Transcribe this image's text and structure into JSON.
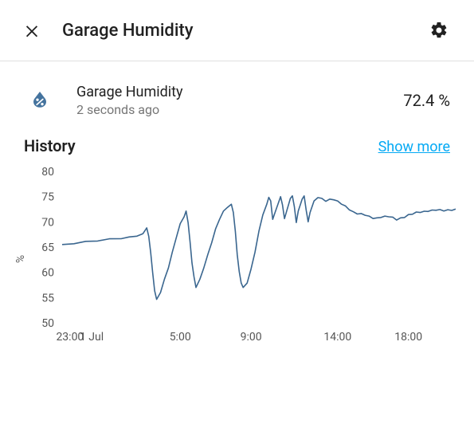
{
  "header": {
    "title": "Garage Humidity"
  },
  "entity": {
    "name": "Garage Humidity",
    "updated": "2 seconds ago",
    "value": "72.4 %"
  },
  "history": {
    "title": "History",
    "show_more": "Show more"
  },
  "colors": {
    "accent": "#03a9f4",
    "series": "#3a668f"
  },
  "chart_data": {
    "type": "line",
    "title": "",
    "xlabel": "",
    "ylabel": "%",
    "ylim": [
      50,
      80
    ],
    "y_ticks": [
      50,
      55,
      60,
      65,
      70,
      75,
      80
    ],
    "x_ticks": [
      {
        "pos": 0.02,
        "label": "23:00"
      },
      {
        "pos": 0.075,
        "label": "1 Jul"
      },
      {
        "pos": 0.3,
        "label": "5:00"
      },
      {
        "pos": 0.48,
        "label": "9:00"
      },
      {
        "pos": 0.7,
        "label": "14:00"
      },
      {
        "pos": 0.88,
        "label": "18:00"
      }
    ],
    "series": [
      {
        "name": "Garage Humidity",
        "points": [
          [
            0.0,
            65.5
          ],
          [
            0.03,
            65.8
          ],
          [
            0.06,
            66.0
          ],
          [
            0.09,
            66.2
          ],
          [
            0.12,
            66.5
          ],
          [
            0.15,
            66.8
          ],
          [
            0.17,
            67.0
          ],
          [
            0.19,
            67.3
          ],
          [
            0.205,
            67.5
          ],
          [
            0.215,
            68.8
          ],
          [
            0.22,
            67.0
          ],
          [
            0.225,
            64.0
          ],
          [
            0.23,
            60.0
          ],
          [
            0.235,
            56.5
          ],
          [
            0.24,
            54.5
          ],
          [
            0.25,
            56.0
          ],
          [
            0.26,
            58.5
          ],
          [
            0.27,
            61.0
          ],
          [
            0.28,
            64.0
          ],
          [
            0.29,
            67.0
          ],
          [
            0.3,
            69.5
          ],
          [
            0.31,
            71.0
          ],
          [
            0.315,
            72.0
          ],
          [
            0.32,
            70.0
          ],
          [
            0.325,
            66.0
          ],
          [
            0.33,
            62.0
          ],
          [
            0.335,
            59.0
          ],
          [
            0.34,
            57.0
          ],
          [
            0.35,
            58.5
          ],
          [
            0.36,
            61.0
          ],
          [
            0.37,
            63.5
          ],
          [
            0.38,
            66.0
          ],
          [
            0.39,
            68.5
          ],
          [
            0.4,
            70.5
          ],
          [
            0.41,
            72.0
          ],
          [
            0.42,
            73.0
          ],
          [
            0.43,
            73.5
          ],
          [
            0.435,
            72.0
          ],
          [
            0.44,
            68.0
          ],
          [
            0.445,
            63.5
          ],
          [
            0.45,
            60.0
          ],
          [
            0.455,
            58.0
          ],
          [
            0.46,
            57.0
          ],
          [
            0.47,
            58.0
          ],
          [
            0.48,
            60.5
          ],
          [
            0.49,
            64.0
          ],
          [
            0.5,
            68.0
          ],
          [
            0.51,
            71.5
          ],
          [
            0.52,
            73.5
          ],
          [
            0.525,
            75.0
          ],
          [
            0.53,
            74.0
          ],
          [
            0.535,
            70.5
          ],
          [
            0.54,
            71.5
          ],
          [
            0.55,
            74.0
          ],
          [
            0.555,
            75.0
          ],
          [
            0.56,
            73.5
          ],
          [
            0.565,
            70.5
          ],
          [
            0.57,
            72.0
          ],
          [
            0.58,
            74.5
          ],
          [
            0.585,
            75.3
          ],
          [
            0.59,
            73.0
          ],
          [
            0.595,
            70.0
          ],
          [
            0.6,
            72.0
          ],
          [
            0.61,
            74.5
          ],
          [
            0.615,
            75.0
          ],
          [
            0.62,
            72.5
          ],
          [
            0.625,
            70.0
          ],
          [
            0.63,
            72.0
          ],
          [
            0.64,
            74.0
          ],
          [
            0.65,
            74.8
          ],
          [
            0.66,
            74.5
          ],
          [
            0.67,
            74.2
          ],
          [
            0.68,
            74.5
          ],
          [
            0.69,
            74.5
          ],
          [
            0.7,
            74.0
          ],
          [
            0.71,
            73.5
          ],
          [
            0.72,
            73.0
          ],
          [
            0.73,
            72.5
          ],
          [
            0.74,
            72.0
          ],
          [
            0.75,
            71.7
          ],
          [
            0.76,
            71.5
          ],
          [
            0.77,
            71.3
          ],
          [
            0.78,
            71.0
          ],
          [
            0.79,
            70.8
          ],
          [
            0.8,
            70.8
          ],
          [
            0.81,
            71.0
          ],
          [
            0.82,
            71.0
          ],
          [
            0.83,
            71.0
          ],
          [
            0.84,
            70.8
          ],
          [
            0.85,
            70.5
          ],
          [
            0.86,
            70.8
          ],
          [
            0.87,
            71.0
          ],
          [
            0.88,
            71.3
          ],
          [
            0.89,
            71.5
          ],
          [
            0.9,
            71.8
          ],
          [
            0.91,
            72.0
          ],
          [
            0.92,
            72.1
          ],
          [
            0.93,
            72.2
          ],
          [
            0.94,
            72.2
          ],
          [
            0.95,
            72.3
          ],
          [
            0.96,
            72.3
          ],
          [
            0.97,
            72.3
          ],
          [
            0.98,
            72.4
          ],
          [
            0.99,
            72.4
          ],
          [
            1.0,
            72.4
          ]
        ]
      }
    ]
  }
}
